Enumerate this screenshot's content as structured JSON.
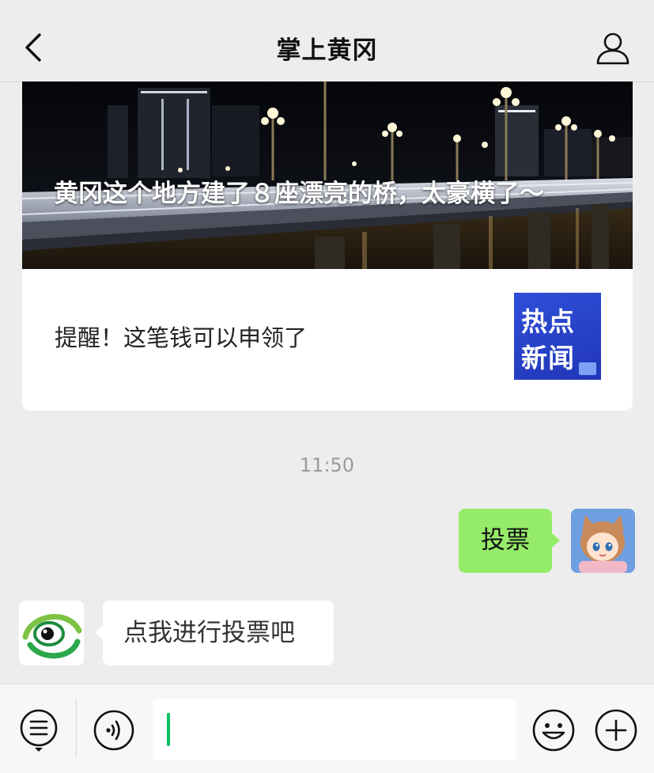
{
  "header": {
    "title": "掌上黄冈",
    "back_icon": "chevron-left-icon",
    "profile_icon": "person-icon"
  },
  "article": {
    "headline": "黄冈这个地方建了８座漂亮的桥，太豪横了～",
    "sub_title": "提醒！这笔钱可以申领了",
    "thumb_line1": "热点",
    "thumb_line2": "新闻"
  },
  "timestamp": "11:50",
  "messages": {
    "outgoing_text": "投票",
    "incoming_text": "点我进行投票吧"
  },
  "input_bar": {
    "placeholder": "",
    "menu_icon": "menu-list-icon",
    "voice_icon": "voice-icon",
    "emoji_icon": "emoji-icon",
    "plus_icon": "plus-icon"
  },
  "colors": {
    "background": "#ededed",
    "outgoing_bubble": "#95ec69",
    "accent_caret": "#07c160",
    "thumb_blue": "#2a44cc"
  }
}
